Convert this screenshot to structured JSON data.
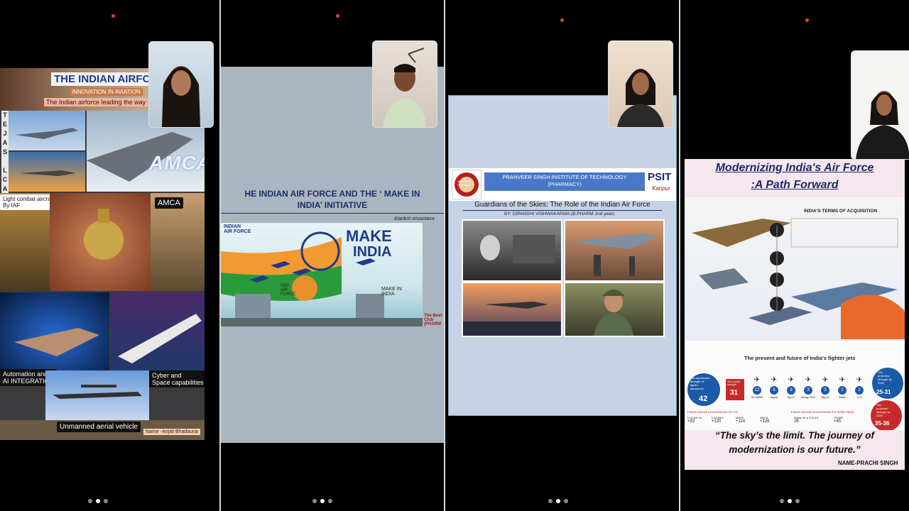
{
  "panel1": {
    "title": "THE INDIAN AIRFORCE",
    "subtitle": "INNOVATION IN AVIATION",
    "tagline": "The Indian airforce leading the way",
    "side_letters": [
      "T",
      "E",
      "J",
      "A",
      "S",
      "",
      "L",
      "C",
      "A"
    ],
    "amca_big": "AMCA",
    "lca_label": "Light combat aircraft\nBy IAF",
    "amca_label": "AMCA",
    "automation_label": "Automation and\nAI INTEGRATION",
    "cyber_label": "Cyber and\nSpace capabilities",
    "uav_label": "Unmanned aerial vehicle",
    "name": "Name -Anjali Bhadauria"
  },
  "panel2": {
    "title_line1": "HE INDIAN AIR FORCE AND THE ‘ MAKE IN",
    "title_line2": "INDIA’ INITIATIVE",
    "author": "Alankrit srivastava",
    "poster_left": "INDIAN\nAIR FORCE",
    "make": "MAKE",
    "india": "INDIA",
    "make_in_india": "MAKE IN\nINDIA",
    "iaf_small": "INDI\nAIR\nFORCE",
    "club": "The Best\nClub\n(PHARM"
  },
  "panel3": {
    "institute": "PRANVEER SINGH INSTITUTE OF TECHNOLOGY\n(PHARMACY)",
    "logo_left": "BASTION\nPharmacy",
    "psit": "PSIT",
    "kanpur": "Kanpur",
    "title": "Guardians of the Skies: The Role of the Indian Air Force",
    "byline": "BY: DIPANSHI VISHWAKARMA (B.PHARM 2nd year)"
  },
  "panel4": {
    "title_line1": "Modernizing India's Air Force",
    "title_line2": ":A Path Forward",
    "terms": "INDIA'S TERMS OF ACQUISITION",
    "fighter_heading": "The present and future of India's fighter jets",
    "sanctioned": "The sanctioned\nstrength of\nfighter\nsquadrons",
    "sanctioned_val": "42",
    "current": "The current\nstrength",
    "current_val": "31",
    "projected1": "The\nprojected\nstrength by\n2025",
    "projected1_val": "25-31",
    "projected2": "The\nprojected\nstrength by\n2035",
    "projected2_val": "35-36",
    "jets": [
      "SU-30MKI",
      "Jaguar",
      "Mig-21",
      "Mirage 2000",
      "Mig-29",
      "Rafale",
      "LCA"
    ],
    "jet_counts": [
      "12",
      "6",
      "3",
      "3",
      "3",
      "2",
      "2"
    ],
    "future_left": "Future aircraft procurements for IAF",
    "future_right": "Future aircraft procurements for Indian Navy",
    "procure": [
      {
        "name": "LCA MK 1A",
        "val": "+83"
      },
      {
        "name": "LCA MK2",
        "val": "+120"
      },
      {
        "name": "MRFA",
        "val": "+114"
      },
      {
        "name": "AMCA",
        "val": "+126"
      },
      {
        "name": "Rafale M or F/A-18",
        "val": "26"
      },
      {
        "name": "TEDBF",
        "val": "+45"
      }
    ],
    "quote_line1": "“The sky’s the limit. The journey of",
    "quote_line2": "modernization is our future.”",
    "name": "NAME-PRACHI SINGH"
  },
  "colors": {
    "rec": "#e0442a",
    "divider": "#d9d9d9",
    "slide2_bg": "#aab6bf",
    "slide3_bg": "#c6d3e6",
    "panel4_title": "#1a2a6b"
  }
}
